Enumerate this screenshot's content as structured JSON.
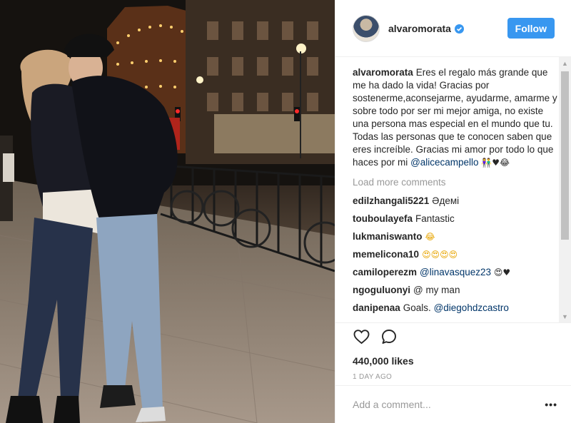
{
  "post": {
    "username": "alvaromorata",
    "follow_label": "Follow",
    "caption_text": "Eres el regalo más grande que me ha dado la vida! Gracias por sostenerme,aconsejarme, ayudarme, amarme y sobre todo por ser mi mejor amiga, no existe una persona mas especial en el mundo que tu. Todas las personas que te conocen saben que eres increíble. Gracias mi amor por todo lo que haces por mi",
    "caption_mention": "@alicecampello",
    "load_more": "Load more comments",
    "likes": "440,000 likes",
    "time": "1 DAY AGO",
    "comment_placeholder": "Add a comment...",
    "more_options": "•••"
  },
  "comments": [
    {
      "user": "edilzhangali5221",
      "text": "Әдемі",
      "mention": ""
    },
    {
      "user": "touboulayefa",
      "text": "Fantastic",
      "mention": ""
    },
    {
      "user": "lukmaniswanto",
      "text": "😂",
      "mention": ""
    },
    {
      "user": "memelicona10",
      "text": "😍😍😍😍",
      "mention": ""
    },
    {
      "user": "camiloperezm",
      "text": "",
      "mention": "@linavasquez23"
    },
    {
      "user": "ngoguluonyi",
      "text": "@ my man",
      "mention": ""
    },
    {
      "user": "danipenaa",
      "text": "Goals.",
      "mention": "@diegohdzcastro"
    }
  ],
  "colors": {
    "accent": "#3897f0",
    "mention": "#003569",
    "muted": "#999999",
    "heart": "#d0021b"
  },
  "icons": [
    "verified-badge-icon",
    "heart-icon",
    "comment-icon",
    "more-options-icon",
    "scroll-up-arrow-icon",
    "scroll-down-arrow-icon"
  ]
}
